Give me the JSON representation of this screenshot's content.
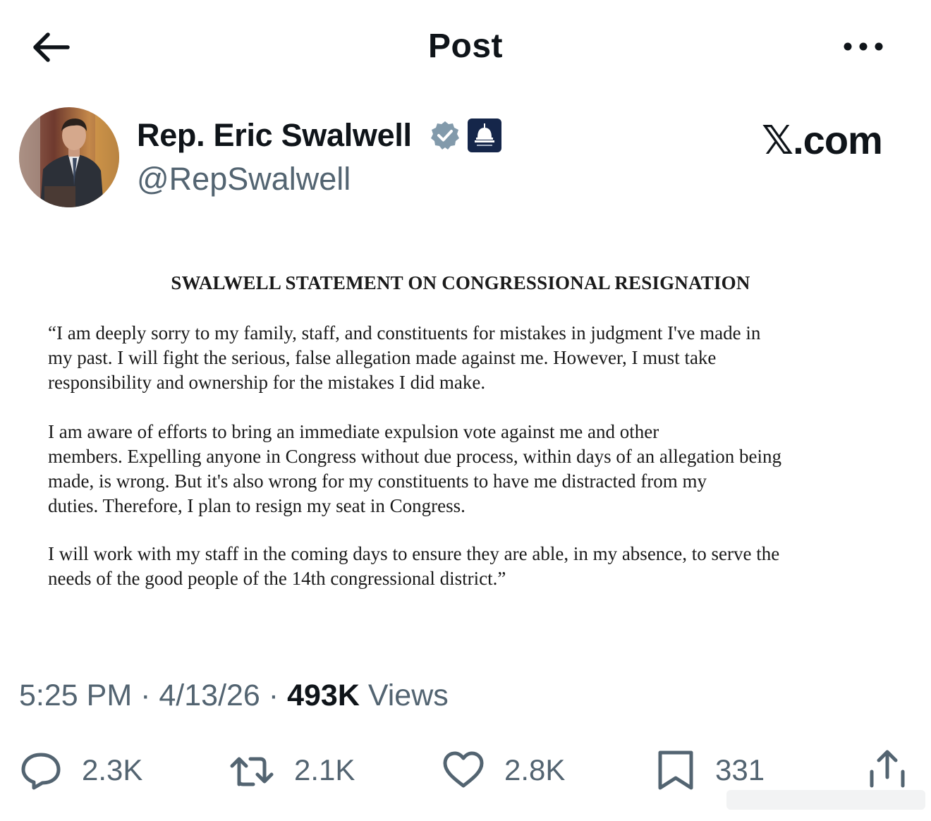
{
  "header": {
    "title": "Post",
    "back_icon": "arrow-left-icon",
    "more_icon": "more-horizontal-icon"
  },
  "author": {
    "name": "Rep. Eric Swalwell",
    "handle": "@RepSwalwell",
    "verified_icon": "verified-badge-icon",
    "verified_color": "#829aab",
    "affiliation_icon": "capitol-dome-icon",
    "affiliation_color": "#15264a"
  },
  "brand": {
    "site": "𝕏.com"
  },
  "statement": {
    "title": "SWALWELL STATEMENT ON CONGRESSIONAL RESIGNATION",
    "paragraphs": [
      [
        "“I am deeply sorry to my family, staff, and constituents for mistakes in judgment I've made in",
        "my past.  I will fight the serious, false allegation made against me. However, I must take",
        "responsibility and ownership for the mistakes I did make."
      ],
      [
        "I am aware of efforts to bring an immediate expulsion vote against me and other",
        "members.  Expelling anyone in Congress without due process, within days of an allegation being",
        "made, is wrong.  But it's also wrong for my constituents to have me distracted from my",
        "duties.  Therefore, I plan to resign my seat in Congress."
      ],
      [
        "I will work with my staff in the coming days to ensure they are able, in my absence, to serve the",
        "needs of the good people of the 14th congressional district.”"
      ]
    ]
  },
  "meta": {
    "time": "5:25 PM",
    "separator": "·",
    "date": "4/13/26",
    "views_count": "493K",
    "views_label": "Views"
  },
  "actions": {
    "reply": {
      "icon": "reply-icon",
      "count": "2.3K"
    },
    "repost": {
      "icon": "repost-icon",
      "count": "2.1K"
    },
    "like": {
      "icon": "heart-icon",
      "count": "2.8K"
    },
    "bookmark": {
      "icon": "bookmark-icon",
      "count": "331"
    },
    "share": {
      "icon": "share-icon"
    }
  },
  "colors": {
    "text_primary": "#0f1419",
    "text_secondary": "#536471",
    "background": "#ffffff"
  }
}
